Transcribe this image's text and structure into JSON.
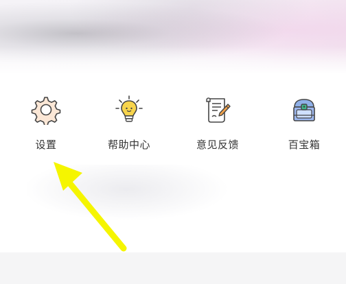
{
  "menu": {
    "items": [
      {
        "label": "设置",
        "icon": "gear-icon"
      },
      {
        "label": "帮助中心",
        "icon": "lightbulb-icon"
      },
      {
        "label": "意见反馈",
        "icon": "scroll-pen-icon"
      },
      {
        "label": "百宝箱",
        "icon": "treasure-chest-icon"
      }
    ]
  },
  "annotation": {
    "type": "yellow-arrow",
    "target": "设置",
    "color": "#f5f500"
  }
}
